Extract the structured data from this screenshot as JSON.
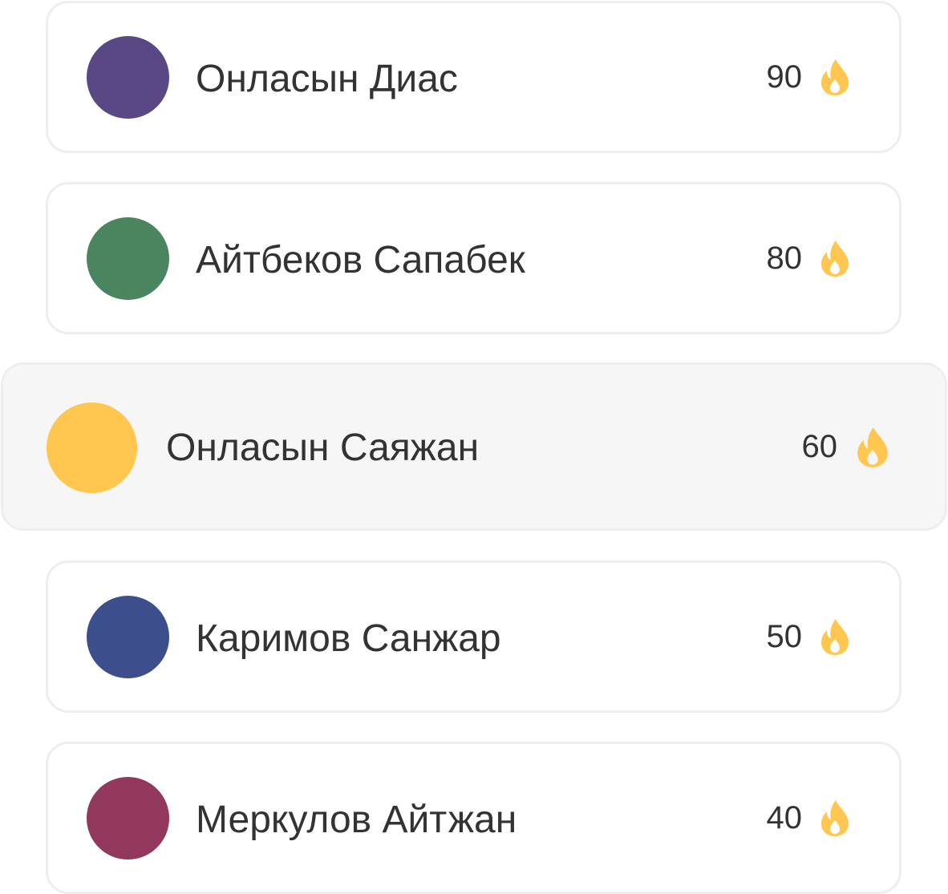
{
  "leaderboard": {
    "entries": [
      {
        "name": "Онласын Диас",
        "score": "90",
        "avatar_color": "#594884",
        "highlighted": false,
        "icon": "flame-icon"
      },
      {
        "name": "Айтбеков Сапабек",
        "score": "80",
        "avatar_color": "#4A8560",
        "highlighted": false,
        "icon": "flame-icon"
      },
      {
        "name": "Онласын Саяжан",
        "score": "60",
        "avatar_color": "#FFC650",
        "highlighted": true,
        "icon": "flame-icon"
      },
      {
        "name": "Каримов Санжар",
        "score": "50",
        "avatar_color": "#3C4F8C",
        "highlighted": false,
        "icon": "flame-icon"
      },
      {
        "name": "Меркулов Айтжан",
        "score": "40",
        "avatar_color": "#93385D",
        "highlighted": false,
        "icon": "flame-icon"
      }
    ],
    "flame_color": "#FFC650"
  }
}
